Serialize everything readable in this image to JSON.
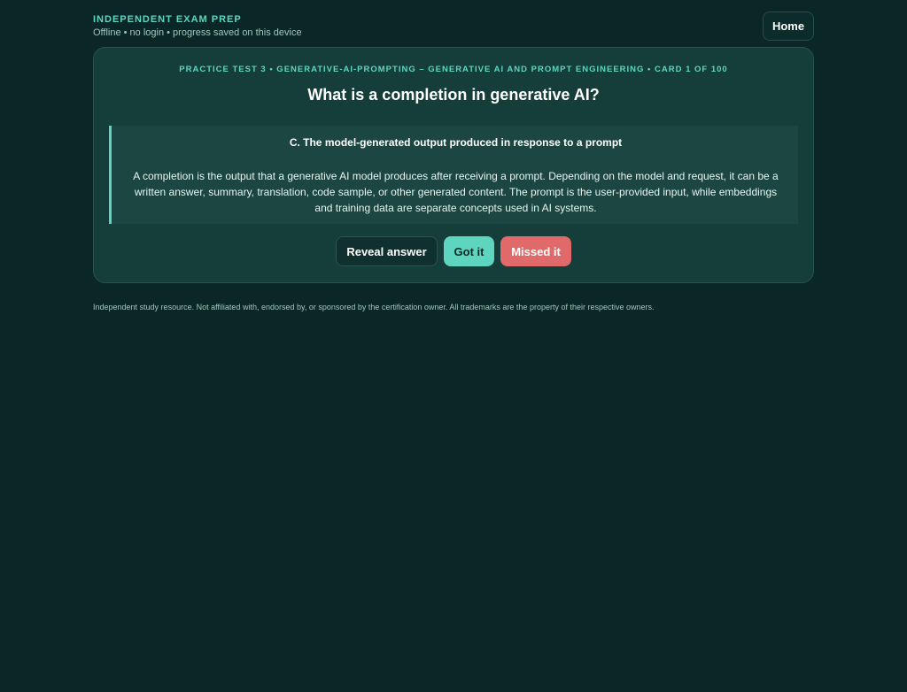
{
  "brand": {
    "name": "INDEPENDENT EXAM PREP",
    "subtitle": "Offline • no login • progress saved on this device"
  },
  "nav": {
    "home_label": "Home"
  },
  "card": {
    "meta": "PRACTICE TEST 3 • GENERATIVE-AI-PROMPTING – GENERATIVE AI AND PROMPT ENGINEERING • CARD 1 OF 100",
    "question": "What is a completion in generative AI?",
    "answer_title": "C. The model-generated output produced in response to a prompt",
    "answer_explanation": "A completion is the output that a generative AI model produces after receiving a prompt. Depending on the model and request, it can be a written answer, summary, translation, code sample, or other generated content. The prompt is the user-provided input, while embeddings and training data are separate concepts used in AI systems."
  },
  "actions": {
    "reveal_label": "Reveal answer",
    "got_label": "Got it",
    "missed_label": "Missed it"
  },
  "footer": {
    "disclaimer": "Independent study resource. Not affiliated with, endorsed by, or sponsored by the certification owner. All trademarks are the property of their respective owners."
  },
  "colors": {
    "background": "#0a2626",
    "card": "#153d3a",
    "accent": "#5ed6bf",
    "danger": "#e06a6a"
  }
}
